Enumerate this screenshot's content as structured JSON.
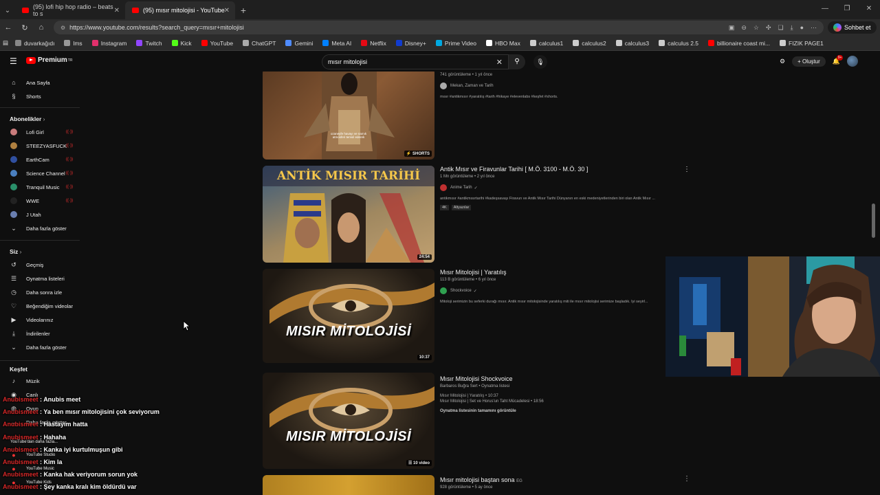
{
  "browser": {
    "tabs": [
      {
        "title": "(95) lofi hip hop radio – beats to s"
      },
      {
        "title": "(95) mısır mitolojisi - YouTube"
      }
    ],
    "url": "https://www.youtube.com/results?search_query=mısır+mitolojisi",
    "chat_button": "Sohbet et",
    "bookmarks": [
      {
        "label": "duvarkağıdı",
        "color": "#888"
      },
      {
        "label": "lms",
        "color": "#999"
      },
      {
        "label": "Instagram",
        "color": "#e1306c"
      },
      {
        "label": "Twitch",
        "color": "#9146ff"
      },
      {
        "label": "Kick",
        "color": "#53fc18"
      },
      {
        "label": "YouTube",
        "color": "#ff0000"
      },
      {
        "label": "ChatGPT",
        "color": "#aaa"
      },
      {
        "label": "Gemini",
        "color": "#4f8cff"
      },
      {
        "label": "Meta AI",
        "color": "#0080ff"
      },
      {
        "label": "Netflix",
        "color": "#e50914"
      },
      {
        "label": "Disney+",
        "color": "#113ccf"
      },
      {
        "label": "Prime Video",
        "color": "#00a8e1"
      },
      {
        "label": "HBO Max",
        "color": "#fff"
      },
      {
        "label": "calculus1",
        "color": "#ccc"
      },
      {
        "label": "calculus2",
        "color": "#ccc"
      },
      {
        "label": "calculus3",
        "color": "#ccc"
      },
      {
        "label": "calculus 2.5",
        "color": "#ccc"
      },
      {
        "label": "billionaire coast mi...",
        "color": "#ff0000"
      },
      {
        "label": "FIZIK PAGE1",
        "color": "#ccc"
      }
    ]
  },
  "youtube": {
    "logo": "Premium",
    "logo_sup": "TR",
    "search_query": "mısır mitolojisi",
    "create_label": "Oluştur",
    "notification_badge": "9+"
  },
  "sidebar": {
    "main": [
      {
        "label": "Ana Sayfa",
        "icon": "home-icon",
        "glyph": "⌂"
      },
      {
        "label": "Shorts",
        "icon": "shorts-icon",
        "glyph": "§"
      }
    ],
    "subscriptions_title": "Abonelikler",
    "subscriptions": [
      {
        "label": "Lofi Girl",
        "color": "#c97b7b"
      },
      {
        "label": "STEEZYASFUCK",
        "color": "#b08040"
      },
      {
        "label": "EarthCam",
        "color": "#3050a0"
      },
      {
        "label": "Science Channel",
        "color": "#4a7fbf"
      },
      {
        "label": "Tranquil Music",
        "color": "#2a8f6a"
      },
      {
        "label": "WWE",
        "color": "#222"
      },
      {
        "label": "J Utah",
        "color": "#6a7fb0"
      }
    ],
    "show_more": "Daha fazla göster",
    "you_title": "Siz",
    "you": [
      {
        "label": "Geçmiş",
        "glyph": "↺"
      },
      {
        "label": "Oynatma listeleri",
        "glyph": "☰"
      },
      {
        "label": "Daha sonra izle",
        "glyph": "◷"
      },
      {
        "label": "Beğendiğim videolar",
        "glyph": "♡"
      },
      {
        "label": "Videolarınız",
        "glyph": "▶"
      },
      {
        "label": "İndirilenler",
        "glyph": "⤓"
      },
      {
        "label": "Daha fazla göster",
        "glyph": "⌄"
      }
    ],
    "explore_title": "Keşfet",
    "explore": [
      {
        "label": "Müzik",
        "glyph": "♪"
      },
      {
        "label": "Canlı",
        "glyph": "◉"
      },
      {
        "label": "Oyun",
        "glyph": "◍"
      },
      {
        "label": "Daha fazla göster",
        "glyph": "⌄"
      }
    ],
    "more_from_youtube": "YouTube'dan daha fazla...",
    "yt_apps": [
      "YouTube Studio",
      "YouTube Music",
      "YouTube Kids"
    ]
  },
  "results": [
    {
      "views": "741 görüntüleme • 1 yıl önce",
      "channel": "Mekan, Zaman ve Tarih",
      "desc": "mısır #antikmısır #yaratılış #tarih #hikaye #elevenlabs #keşfet #shorts.",
      "badge": "SHORTS",
      "thumb_caption": "ozaneyfe havayı ve namık atmosferi temsil ederek"
    },
    {
      "title": "Antik Mısır ve Firavunlar Tarihi [ M.Ö. 3100 - M.Ö. 30 ]",
      "views": "1 Mn görüntüleme • 2 yıl önce",
      "channel": "Anime Tarih",
      "desc": "antikmısır #antikmısırtarihi #kadeşsavaşı Firavun ve Antik Mısır Tarihi Dünyanın en eski medeniyetlerinden biri olan Antik Mısır ...",
      "tags": [
        "4K",
        "Altyazılar"
      ],
      "duration": "24:54",
      "thumb_title": "ANTİK MISIR TARİHİ"
    },
    {
      "title": "Mısır Mitolojisi | Yaratılış",
      "views": "113 B görüntüleme • 6 yıl önce",
      "channel": "Shockvoice",
      "desc": "Mitoloji serimizin bu seferki durağı mısır. Antik mısır mitolojisinde yaratılış miti ile mısır mitolojisi serimize başladık. İyi seyirl...",
      "duration": "10:37",
      "thumb_title": "MISIR MİTOLOJİSİ"
    },
    {
      "title": "Mısır Mitolojisi Shockvoice",
      "channel_line": "Barbaros Buğra Sert • Oynatma listesi",
      "playlist_items": [
        "Mısır Mitolojisi | Yaratılış • 10:37",
        "Mısır Mitolojisi | Set ve Horus'un Taht Mücadelesi • 18:56"
      ],
      "view_all": "Oynatma listesinin tamamını görüntüle",
      "duration": "10 video",
      "thumb_title": "MISIR MİTOLOJİSİ"
    },
    {
      "title": "Mısır mitolojisi baştan sona",
      "title_badge": "EG",
      "views": "928 görüntüleme • 5 ay önce"
    }
  ],
  "chat": [
    {
      "user": "Anubismeet",
      "text": "Anubis meet"
    },
    {
      "user": "Anubismeet",
      "text": "Ya ben mısır mitolojisini çok seviyorum"
    },
    {
      "user": "Anubismeet",
      "text": "Hastayım hatta"
    },
    {
      "user": "Anubismeet",
      "text": "Hahaha"
    },
    {
      "user": "Anubismeet",
      "text": "Kanka iyi kurtulmuşun gibi"
    },
    {
      "user": "Anubismeet",
      "text": "Kim la"
    },
    {
      "user": "Anubismeet",
      "text": "Kanka hak veriyorum sorun yok"
    },
    {
      "user": "Anubismeet",
      "text": "Şey kanka kralı kim öldürdü var"
    }
  ]
}
